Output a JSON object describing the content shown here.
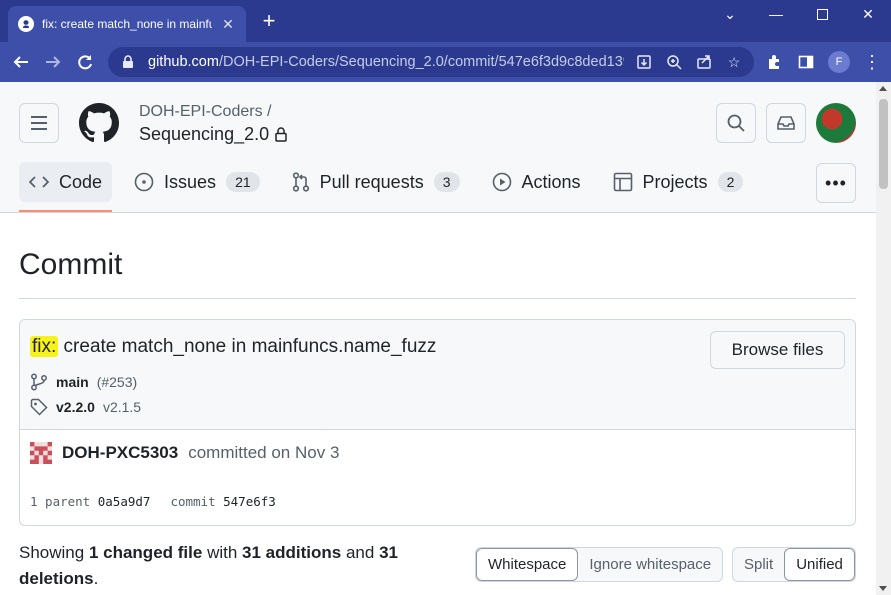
{
  "browser": {
    "tab_title": "fix: create match_none in mainfu",
    "url_host": "github.com",
    "url_path": "/DOH-EPI-Coders/Sequencing_2.0/commit/547e6f3d9c8ded139...",
    "profile_initial": "F"
  },
  "header": {
    "owner": "DOH-EPI-Coders /",
    "repo": "Sequencing_2.0"
  },
  "nav": {
    "code": "Code",
    "issues": "Issues",
    "issues_count": "21",
    "pulls": "Pull requests",
    "pulls_count": "3",
    "actions": "Actions",
    "projects": "Projects",
    "projects_count": "2"
  },
  "page": {
    "title": "Commit"
  },
  "commit": {
    "prefix": "fix:",
    "message": " create match_none in mainfuncs.name_fuzz",
    "browse_label": "Browse files",
    "branch": "main",
    "pr_ref": "(#253)",
    "tag_primary": "v2.2.0",
    "tag_secondary": "v2.1.5",
    "author": "DOH-PXC5303",
    "committed_text": "committed on Nov 3",
    "parent_label": "1 parent",
    "parent_sha": "0a5a9d7",
    "commit_label": "commit",
    "commit_sha": "547e6f3"
  },
  "summary": {
    "showing": "Showing",
    "changed": "1 changed file",
    "with": "with",
    "additions": "31 additions",
    "and": "and",
    "deletions": "31 deletions",
    "period": "."
  },
  "diff_options": {
    "whitespace": "Whitespace",
    "ignore_whitespace": "Ignore whitespace",
    "split": "Split",
    "unified": "Unified"
  },
  "colors": {
    "browser_frame": "#2b3a8f",
    "highlight": "#f6f31c",
    "nav_underline": "#fd8c73"
  }
}
